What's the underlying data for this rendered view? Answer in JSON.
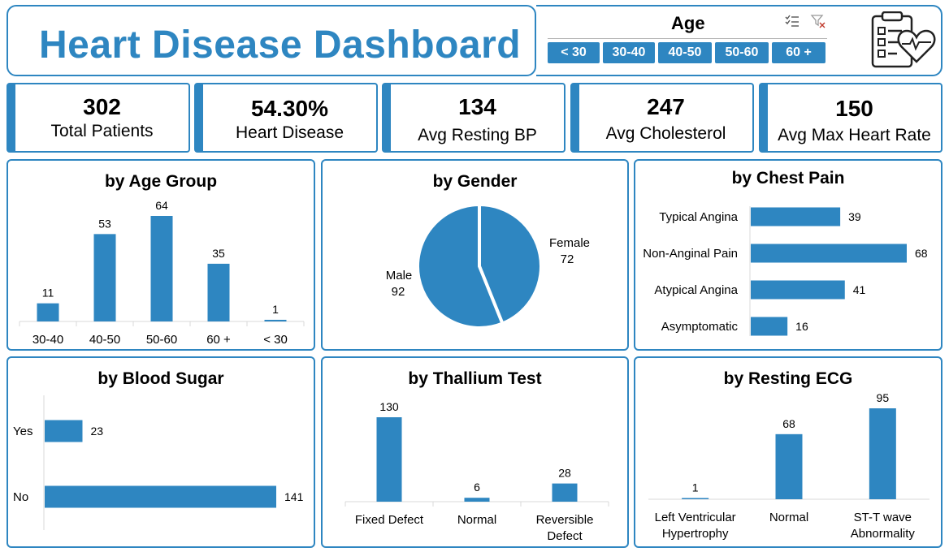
{
  "header": {
    "title": "Heart Disease Dashboard"
  },
  "slicer": {
    "title": "Age",
    "options": [
      "< 30",
      "30-40",
      "40-50",
      "50-60",
      "60 +"
    ],
    "multi_select_icon": "multi-select-icon",
    "clear_filter_icon": "clear-filter-icon"
  },
  "logo": {
    "icon": "clipboard-heart-icon"
  },
  "kpis": [
    {
      "value": "302",
      "label": "Total Patients"
    },
    {
      "value": "54.30%",
      "label": "Heart Disease"
    },
    {
      "value": "134",
      "label": "Avg Resting BP"
    },
    {
      "value": "247",
      "label": "Avg Cholesterol"
    },
    {
      "value": "150",
      "label": "Avg Max Heart Rate"
    }
  ],
  "colors": {
    "accent": "#2e86c1"
  },
  "chart_data": [
    {
      "type": "bar",
      "title": "by Age Group",
      "categories": [
        "30-40",
        "40-50",
        "50-60",
        "60 +",
        "< 30"
      ],
      "values": [
        11,
        53,
        64,
        35,
        1
      ],
      "ylim": [
        0,
        64
      ]
    },
    {
      "type": "pie",
      "title": "by Gender",
      "categories": [
        "Female",
        "Male"
      ],
      "values": [
        72,
        92
      ]
    },
    {
      "type": "bar",
      "orientation": "horizontal",
      "title": "by Chest Pain",
      "categories": [
        "Typical Angina",
        "Non-Anginal Pain",
        "Atypical Angina",
        "Asymptomatic"
      ],
      "values": [
        39,
        68,
        41,
        16
      ]
    },
    {
      "type": "bar",
      "orientation": "horizontal",
      "title": "by Blood Sugar",
      "categories": [
        "Yes",
        "No"
      ],
      "values": [
        23,
        141
      ]
    },
    {
      "type": "bar",
      "title": "by Thallium Test",
      "categories": [
        "Fixed Defect",
        "Normal",
        "Reversible Defect"
      ],
      "values": [
        130,
        6,
        28
      ]
    },
    {
      "type": "bar",
      "title": "by Resting ECG",
      "categories": [
        "Left Ventricular Hypertrophy",
        "Normal",
        "ST-T wave Abnormality"
      ],
      "values": [
        1,
        68,
        95
      ]
    }
  ]
}
